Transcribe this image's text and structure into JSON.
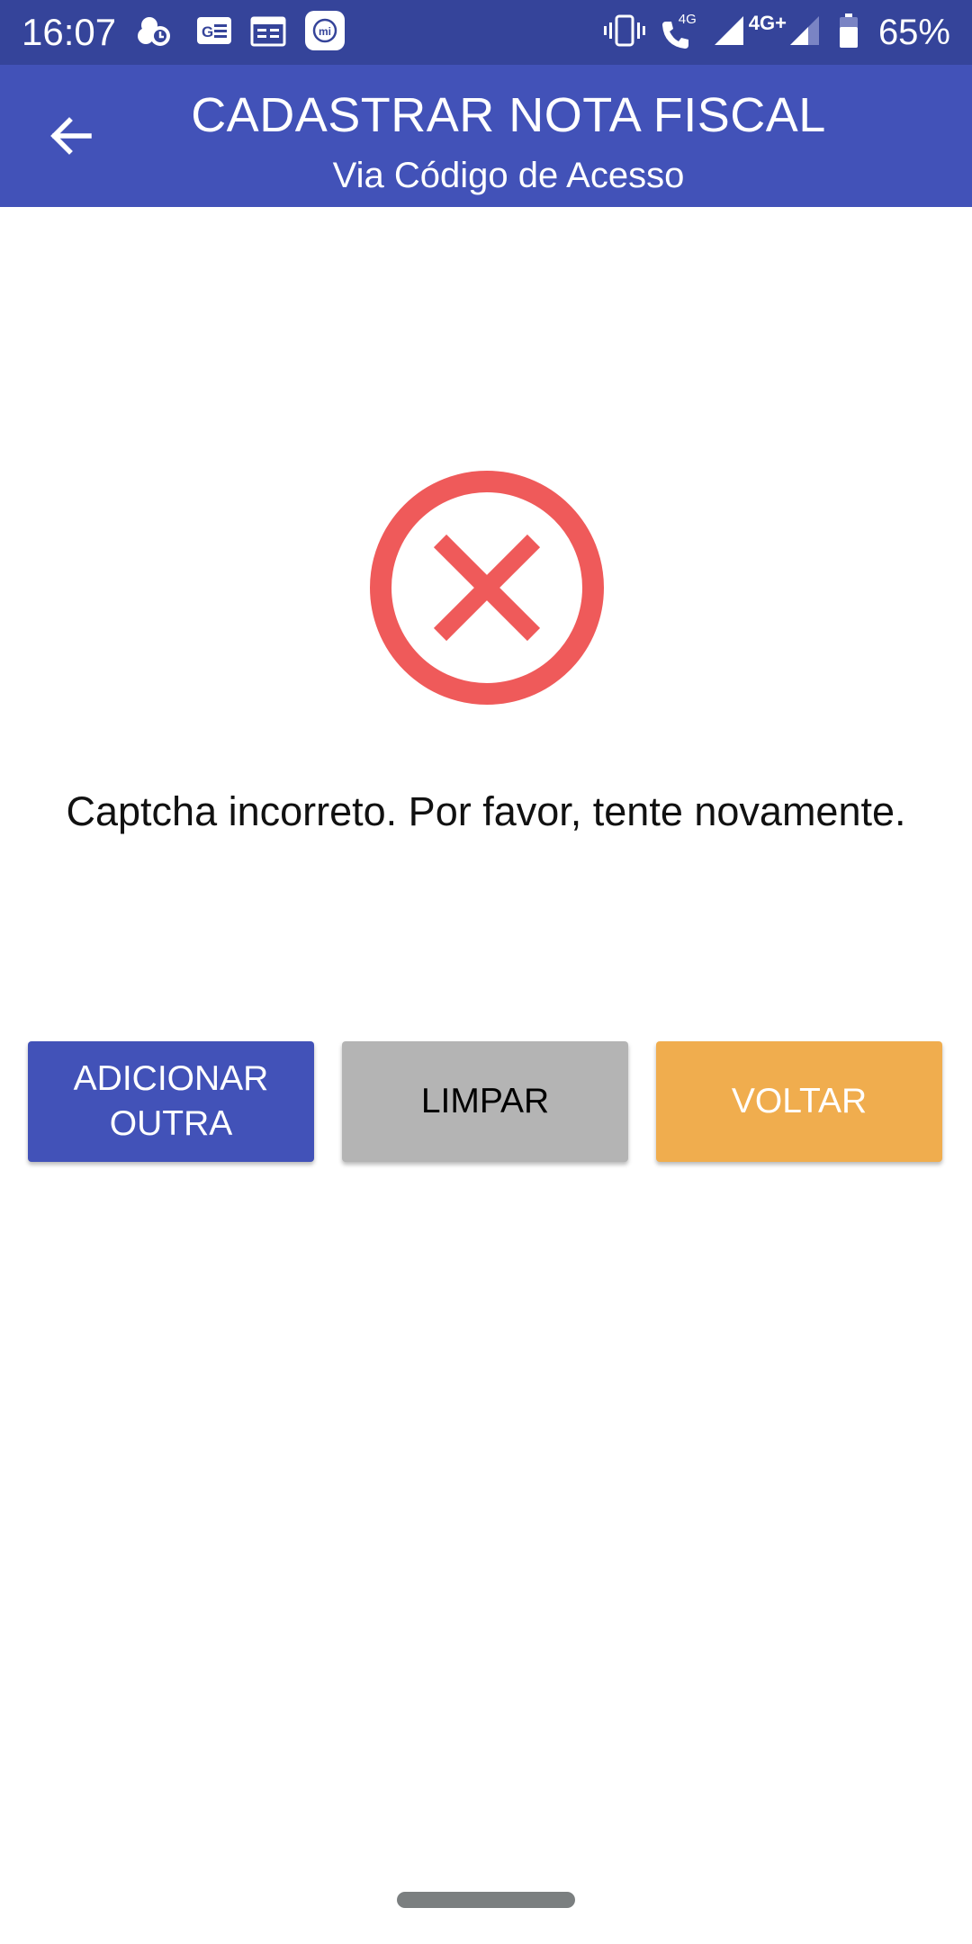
{
  "status_bar": {
    "time": "16:07",
    "left_icons": [
      "weather-icon",
      "news-icon",
      "calendar-icon",
      "mi-app-icon"
    ],
    "right_icons": [
      "vibrate-icon",
      "volte-call-icon",
      "signal-icon",
      "signal-icon"
    ],
    "call_network_label": "4G",
    "network_label": "4G+",
    "battery_percent": "65%"
  },
  "app_bar": {
    "back_icon": "arrow-left-icon",
    "title": "CADASTRAR NOTA FISCAL",
    "subtitle": "Via Código de Acesso"
  },
  "result": {
    "icon": "error-circle-x-icon",
    "icon_color": "#ef5a5a",
    "message": "Captcha incorreto. Por favor, tente novamente."
  },
  "actions": {
    "add_label": "ADICIONAR OUTRA",
    "clear_label": "LIMPAR",
    "back_label": "VOLTAR"
  },
  "colors": {
    "status_bar": "#35449a",
    "primary": "#4252b8",
    "clear_button": "#b4b4b4",
    "back_button": "#f0ad4e"
  }
}
